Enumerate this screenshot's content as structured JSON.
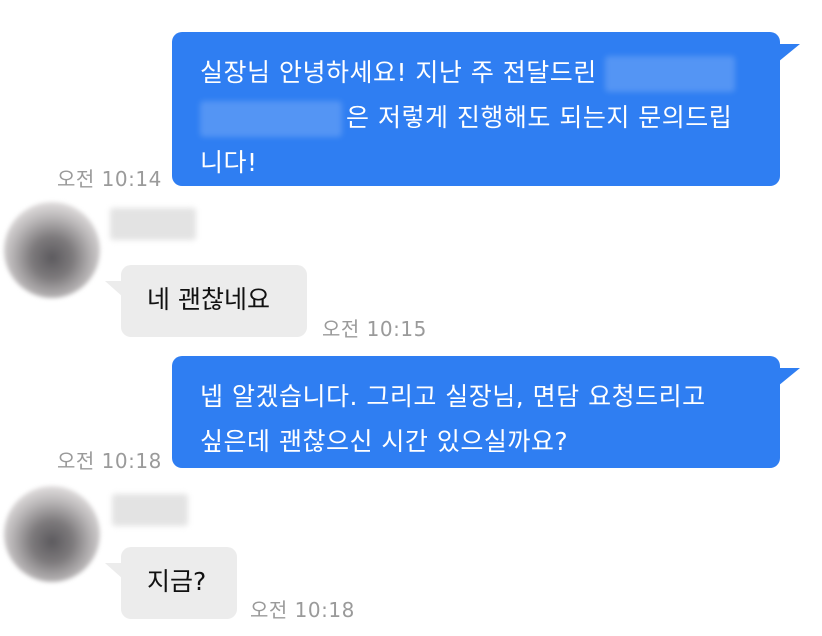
{
  "messages": [
    {
      "side": "sent",
      "line1": "실장님 안녕하세요! 지난 주 전달드린",
      "line2": "은 저렇게 진행해도 되는지 문의드립",
      "line3": "니다!",
      "time": "오전 10:14"
    },
    {
      "side": "received",
      "text": "네 괜찮네요",
      "time": "오전 10:15"
    },
    {
      "side": "sent",
      "line1": "넵 알겠습니다. 그리고 실장님, 면담 요청드리고",
      "line2": "싶은데 괜찮으신 시간 있으실까요?",
      "time": "오전 10:18"
    },
    {
      "side": "received",
      "text": "지금?",
      "time": "오전 10:18"
    }
  ],
  "colors": {
    "sent_bubble": "#2f7ef2",
    "received_bubble": "#ececec",
    "timestamp": "#9a9a9a",
    "background": "#ffffff"
  }
}
